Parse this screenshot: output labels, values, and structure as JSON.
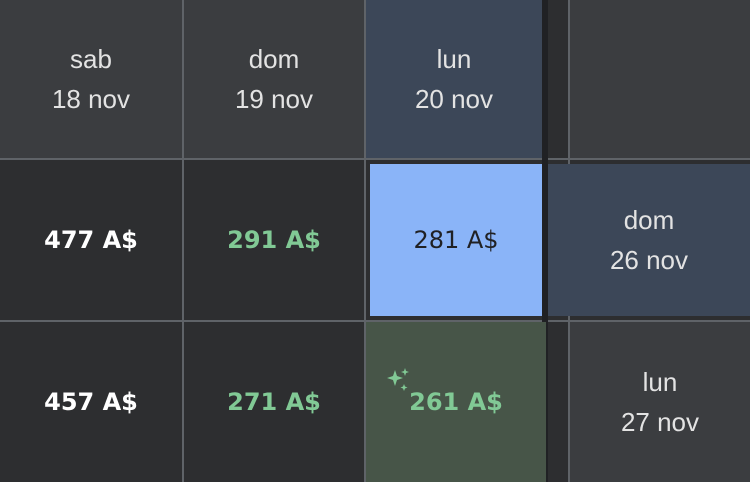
{
  "header_row": [
    {
      "dow": "sab",
      "date": "18 nov"
    },
    {
      "dow": "dom",
      "date": "19 nov"
    },
    {
      "dow": "lun",
      "date": "20 nov"
    }
  ],
  "side_col": [
    {
      "dow": "dom",
      "date": "26 nov"
    },
    {
      "dow": "lun",
      "date": "27 nov"
    }
  ],
  "row1": {
    "c1": "477 A$",
    "c2": "291 A$",
    "c3": "281 A$"
  },
  "row2": {
    "c1": "457 A$",
    "c2": "271 A$",
    "c3": "261 A$"
  },
  "icons": {
    "best": "sparkle-icon"
  },
  "colors": {
    "selected": "#8ab4f8",
    "cheap": "#81c995",
    "best_bg": "#475548"
  }
}
